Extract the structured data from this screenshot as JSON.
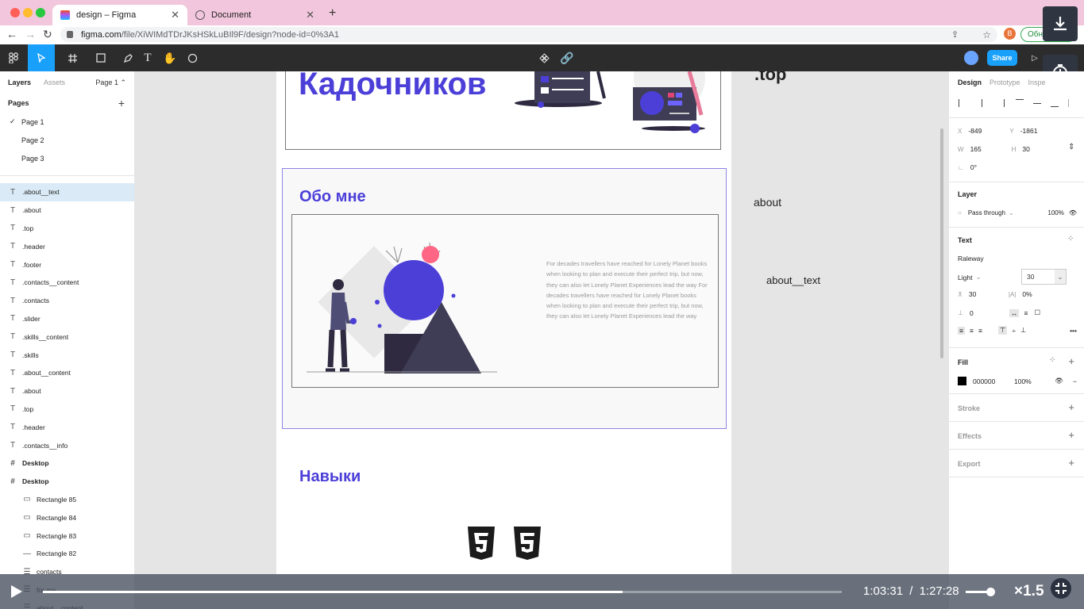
{
  "browser": {
    "tabs": [
      {
        "title": "design – Figma",
        "active": true
      },
      {
        "title": "Document",
        "active": false
      }
    ],
    "url_host": "figma.com",
    "url_path": "/file/XiWIMdTDrJKsHSkLuBIl9F/design?node-id=0%3A1",
    "profile_initial": "B",
    "update_label": "Обн"
  },
  "toolbar": {
    "share_label": "Share"
  },
  "left_panel": {
    "tabs": {
      "layers": "Layers",
      "assets": "Assets",
      "page": "Page 1 ⌃"
    },
    "pages_heading": "Pages",
    "pages": [
      "Page 1",
      "Page 2",
      "Page 3"
    ],
    "layers": [
      {
        "name": ".about__text",
        "icon": "text-icon",
        "selected": true
      },
      {
        "name": ".about",
        "icon": "text-icon"
      },
      {
        "name": ".top",
        "icon": "text-icon"
      },
      {
        "name": ".header",
        "icon": "text-icon"
      },
      {
        "name": ".footer",
        "icon": "text-icon"
      },
      {
        "name": ".contacts__content",
        "icon": "text-icon"
      },
      {
        "name": ".contacts",
        "icon": "text-icon"
      },
      {
        "name": ".slider",
        "icon": "text-icon"
      },
      {
        "name": ".skills__content",
        "icon": "text-icon"
      },
      {
        "name": ".skills",
        "icon": "text-icon"
      },
      {
        "name": ".about__content",
        "icon": "text-icon"
      },
      {
        "name": ".about",
        "icon": "text-icon"
      },
      {
        "name": ".top",
        "icon": "text-icon"
      },
      {
        "name": ".header",
        "icon": "text-icon"
      },
      {
        "name": ".contacts__info",
        "icon": "text-icon"
      },
      {
        "name": "Desktop",
        "icon": "frame-icon",
        "bold": true
      },
      {
        "name": "Desktop",
        "icon": "frame-icon",
        "bold": true
      },
      {
        "name": "Rectangle 85",
        "icon": "rect-icon",
        "indent": true
      },
      {
        "name": "Rectangle 84",
        "icon": "rect-icon",
        "indent": true
      },
      {
        "name": "Rectangle 83",
        "icon": "rect-icon",
        "indent": true
      },
      {
        "name": "Rectangle 82",
        "icon": "line-icon",
        "indent": true
      },
      {
        "name": "contacts",
        "icon": "group-icon",
        "indent": true
      },
      {
        "name": "for me",
        "icon": "group-icon",
        "indent": true
      },
      {
        "name": "about__content",
        "icon": "group-icon",
        "indent": true
      }
    ]
  },
  "canvas": {
    "surname": "Кадочников",
    "about_title": "Обо мне",
    "about_text": "For decades travellers have reached for Lonely Planet books when looking to plan and execute their perfect trip, but now, they can also let Lonely Planet Experiences lead the way For decades travellers have reached for Lonely Planet books when looking to plan and execute their perfect trip, but now, they can also let Lonely Planet Experiences lead the way",
    "skills_title": "Навыки",
    "side_labels": {
      "top": ".top",
      "about": "about",
      "about_text": "about__text"
    }
  },
  "right_panel": {
    "tabs": {
      "design": "Design",
      "prototype": "Prototype",
      "inspect": "Inspe"
    },
    "x_label": "X",
    "x": "-849",
    "y_label": "Y",
    "y": "-1861",
    "w_label": "W",
    "w": "165",
    "h_label": "H",
    "h": "30",
    "rotation": "0°",
    "layer_heading": "Layer",
    "blend_mode": "Pass through",
    "layer_opacity": "100%",
    "text_heading": "Text",
    "font_family": "Raleway",
    "font_weight": "Light",
    "font_size": "30",
    "line_height": "30",
    "letter_spacing": "0%",
    "paragraph_spacing": "0",
    "fill_heading": "Fill",
    "fill_hex": "000000",
    "fill_opacity": "100%",
    "stroke_heading": "Stroke",
    "effects_heading": "Effects",
    "export_heading": "Export"
  },
  "video": {
    "current_time": "1:03:31",
    "separator": "/",
    "duration": "1:27:28",
    "speed": "×1.5",
    "progress_fraction": 0.726
  },
  "colors": {
    "accent": "#4b3fd8",
    "figma_blue": "#18a0fb",
    "tabbar_pink": "#f2c6dc"
  }
}
